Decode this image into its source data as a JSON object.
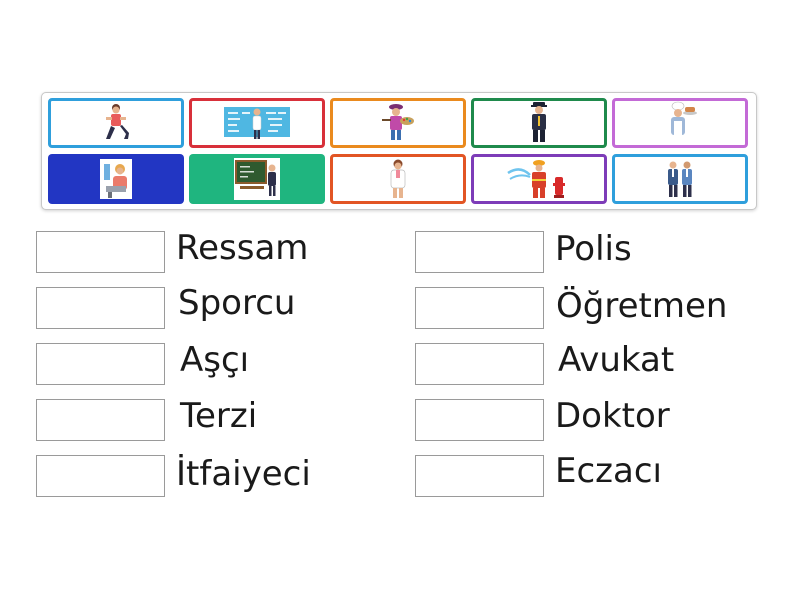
{
  "tiles": [
    {
      "image": "athlete-stretching-icon",
      "border_color": "#2f9fdc"
    },
    {
      "image": "teacher-at-board-icon",
      "border_color": "#d8303a"
    },
    {
      "image": "painter-icon",
      "border_color": "#ea8a1e"
    },
    {
      "image": "police-officer-icon",
      "border_color": "#1f8a4c"
    },
    {
      "image": "chef-icon",
      "border_color": "#c36ad6"
    },
    {
      "image": "tailor-icon",
      "border_color": "#2236c3",
      "filled": true
    },
    {
      "image": "teacher-chalkboard-icon",
      "border_color": "#1fb57f",
      "filled": true
    },
    {
      "image": "doctor-icon",
      "border_color": "#e25524"
    },
    {
      "image": "firefighter-icon",
      "border_color": "#7d3cb8"
    },
    {
      "image": "lawyers-icon",
      "border_color": "#2f9fdc"
    }
  ],
  "words_left": [
    "Ressam",
    "Sporcu",
    "Aşçı",
    "Terzi",
    "İtfaiyeci"
  ],
  "words_right": [
    "Polis",
    "Öğretmen",
    "Avukat",
    "Doktor",
    "Eczacı"
  ]
}
